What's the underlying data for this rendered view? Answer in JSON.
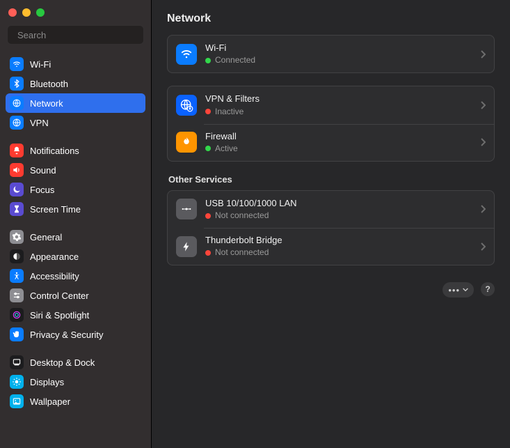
{
  "header": {
    "title": "Network"
  },
  "search": {
    "placeholder": "Search"
  },
  "sidebar": {
    "groups": [
      {
        "items": [
          {
            "id": "wifi",
            "label": "Wi-Fi",
            "selected": false
          },
          {
            "id": "bluetooth",
            "label": "Bluetooth",
            "selected": false
          },
          {
            "id": "network",
            "label": "Network",
            "selected": true
          },
          {
            "id": "vpn",
            "label": "VPN",
            "selected": false
          }
        ]
      },
      {
        "items": [
          {
            "id": "notifications",
            "label": "Notifications",
            "selected": false
          },
          {
            "id": "sound",
            "label": "Sound",
            "selected": false
          },
          {
            "id": "focus",
            "label": "Focus",
            "selected": false
          },
          {
            "id": "screentime",
            "label": "Screen Time",
            "selected": false
          }
        ]
      },
      {
        "items": [
          {
            "id": "general",
            "label": "General",
            "selected": false
          },
          {
            "id": "appearance",
            "label": "Appearance",
            "selected": false
          },
          {
            "id": "accessibility",
            "label": "Accessibility",
            "selected": false
          },
          {
            "id": "controlcenter",
            "label": "Control Center",
            "selected": false
          },
          {
            "id": "siri",
            "label": "Siri & Spotlight",
            "selected": false
          },
          {
            "id": "privacy",
            "label": "Privacy & Security",
            "selected": false
          }
        ]
      },
      {
        "items": [
          {
            "id": "desktop",
            "label": "Desktop & Dock",
            "selected": false
          },
          {
            "id": "displays",
            "label": "Displays",
            "selected": false
          },
          {
            "id": "wallpaper",
            "label": "Wallpaper",
            "selected": false
          }
        ]
      }
    ]
  },
  "main": {
    "primary": [
      {
        "id": "wifi",
        "title": "Wi-Fi",
        "status": "Connected",
        "color": "#32d74b"
      }
    ],
    "secondary": [
      {
        "id": "vpnfilters",
        "title": "VPN & Filters",
        "status": "Inactive",
        "color": "#ff453a"
      },
      {
        "id": "firewall",
        "title": "Firewall",
        "status": "Active",
        "color": "#32d74b"
      }
    ],
    "other_label": "Other Services",
    "other": [
      {
        "id": "usblan",
        "title": "USB 10/100/1000 LAN",
        "status": "Not connected",
        "color": "#ff453a"
      },
      {
        "id": "thunderbolt",
        "title": "Thunderbolt Bridge",
        "status": "Not connected",
        "color": "#ff453a"
      }
    ]
  },
  "footer": {
    "more": "…",
    "help": "?"
  }
}
